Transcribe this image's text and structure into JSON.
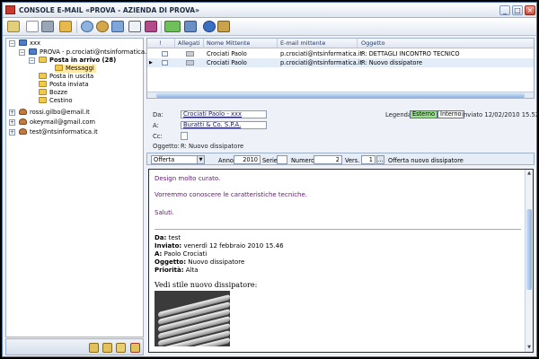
{
  "window": {
    "title": "CONSOLE E-MAIL «PROVA - AZIENDA DI PROVA»"
  },
  "tree": {
    "root": "xxx",
    "account": "PROVA - p.crociati@ntsinformatica.it",
    "inbox": "Posta in arrivo (28)",
    "messages": "Messaggi",
    "outbox": "Posta in uscita",
    "sent": "Posta inviata",
    "drafts": "Bozze",
    "trash": "Cestino",
    "other_accounts": [
      "rossi.gilbo@email.it",
      "okeymail@gmail.com",
      "test@ntsinformatica.it"
    ]
  },
  "list": {
    "headers": [
      "!",
      "Allegati",
      "Nome Mittente",
      "E-mail mittente",
      "Oggetto"
    ],
    "rows": [
      {
        "sender": "Crociati Paolo",
        "email": "p.crociati@ntsinformatica.it",
        "subject": "R: DETTAGLI INCONTRO TECNICO"
      },
      {
        "sender": "Crociati Paolo",
        "email": "p.crociati@ntsinformatica.it",
        "subject": "R: Nuovo dissipatore"
      }
    ]
  },
  "header": {
    "da_label": "Da:",
    "da_value": "Crociati Paolo - xxx",
    "a_label": "A:",
    "a_value": "Buratti & Co. S.P.A.",
    "cc_label": "Cc:",
    "oggetto_label": "Oggetto:",
    "oggetto_value": "R: Nuovo dissipatore",
    "legend_label": "Legenda:",
    "tag_esterno": "Esterno",
    "tag_interno": "Interno",
    "sent_info": "Inviato 12/02/2010 15.52.49",
    "colors": {
      "esterno": "#9be28f",
      "interno": "#ffffff"
    }
  },
  "meta": {
    "doc_type": "Offerta",
    "anno_label": "Anno",
    "anno_value": "2010",
    "serie_label": "Serie",
    "numero_label": "Numero",
    "numero_value": "2",
    "vers_label": "Vers.",
    "vers_value": "1",
    "doc_desc": "Offerta nuovo dissipatore"
  },
  "body": {
    "line1": "Design molto  curato.",
    "line2": "Vorremmo conoscere le caratteristiche tecniche.",
    "line3": "Saluti.",
    "q_da_label": "Da:",
    "q_da_value": "test",
    "q_inviato_label": "Inviato:",
    "q_inviato_value": "venerdì 12 febbraio 2010 15.46",
    "q_a_label": "A:",
    "q_a_value": "Paolo Crociati",
    "q_oggetto_label": "Oggetto:",
    "q_oggetto_value": "Nuovo dissipatore",
    "q_priorita_label": "Priorità:",
    "q_priorita_value": "Alta",
    "q_text": "Vedi stile nuovo dissipatore:"
  }
}
